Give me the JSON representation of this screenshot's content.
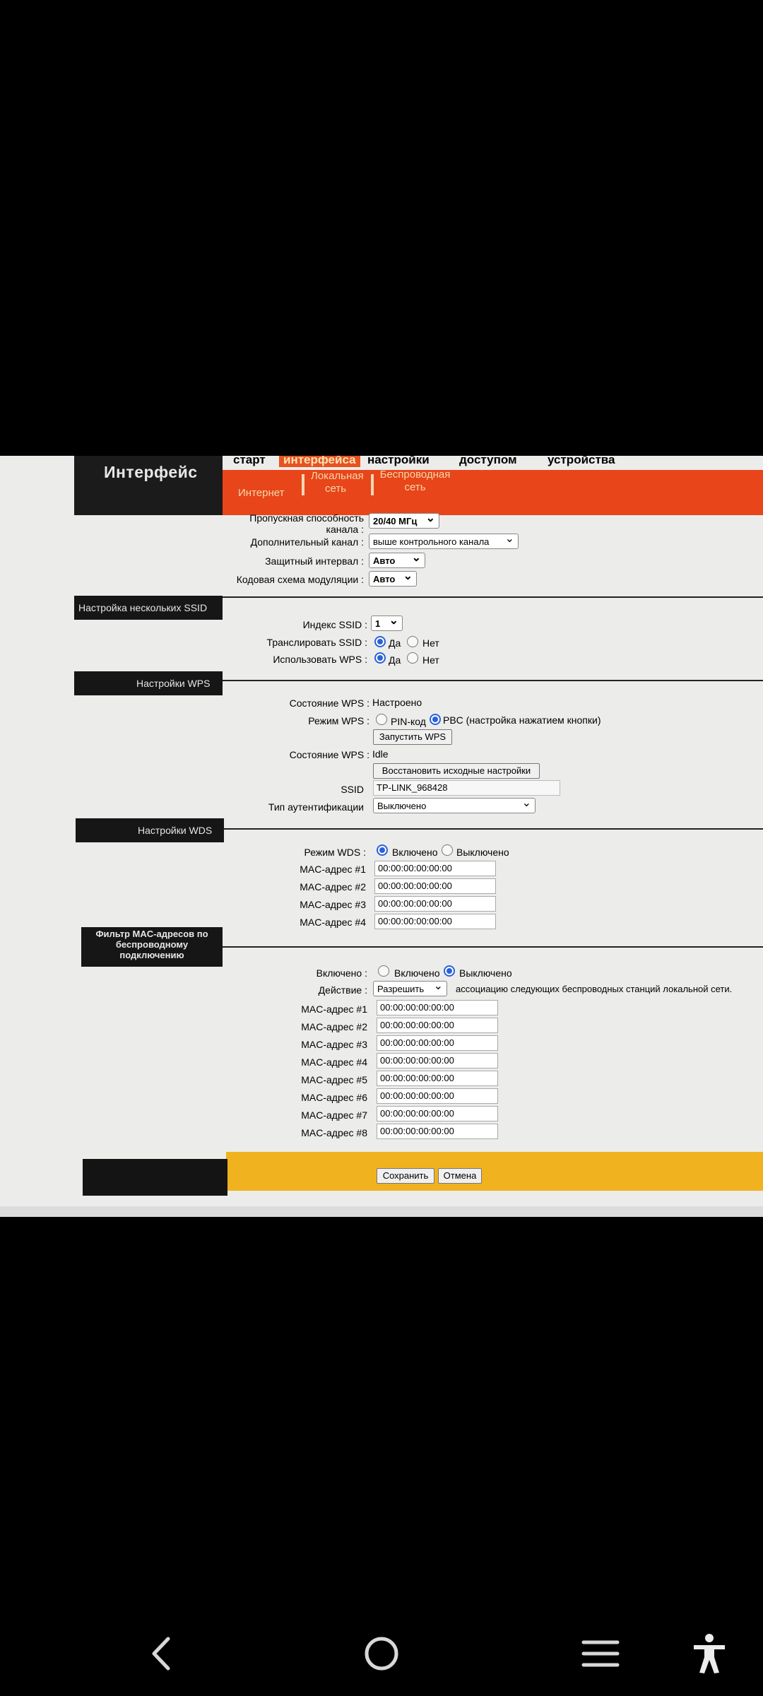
{
  "brand": "Интерфейс",
  "top_menu": [
    "старт",
    "интерфейса",
    "настройки",
    "доступом",
    "устройства"
  ],
  "sub_nav": [
    "Интернет",
    "Локальная\nсеть",
    "Беспроводная\nсеть"
  ],
  "wireless": {
    "bandwidth_label": "Пропускная способность канала",
    "bandwidth_value": "20/40 МГц",
    "ext_channel_label": "Дополнительный канал",
    "ext_channel_value": "выше контрольного канала",
    "guard_label": "Защитный интервал",
    "guard_value": "Авто",
    "mcs_label": "Кодовая схема модуляции",
    "mcs_value": "Авто"
  },
  "multi_ssid": {
    "title": "Настройка нескольких SSID",
    "index_label": "Индекс SSID",
    "index_value": "1",
    "broadcast_label": "Транслировать SSID",
    "use_wps_label": "Использовать WPS",
    "yes": "Да",
    "no": "Нет"
  },
  "wps": {
    "title": "Настройки WPS",
    "state_label": "Состояние WPS",
    "state_value": "Настроено",
    "mode_label": "Режим WPS",
    "pin_label": "PIN-код",
    "pbc_label": "PBC (настройка нажатием кнопки)",
    "start_button": "Запустить WPS",
    "state2_label": "Состояние WPS",
    "state2_value": "Idle",
    "restore_button": "Восстановить исходные настройки",
    "ssid_label": "SSID",
    "ssid_value": "TP-LINK_968428",
    "auth_label": "Тип аутентификации",
    "auth_value": "Выключено"
  },
  "wds": {
    "title": "Настройки WDS",
    "mode_label": "Режим WDS",
    "on": "Включено",
    "off": "Выключено",
    "macs": [
      {
        "label": "MAC-адрес #1",
        "value": "00:00:00:00:00:00"
      },
      {
        "label": "MAC-адрес #2",
        "value": "00:00:00:00:00:00"
      },
      {
        "label": "MAC-адрес #3",
        "value": "00:00:00:00:00:00"
      },
      {
        "label": "MAC-адрес #4",
        "value": "00:00:00:00:00:00"
      }
    ]
  },
  "mac_filter": {
    "title": "Фильтр MAC-адресов по беспроводному подключению",
    "enabled_label": "Включено",
    "on": "Включено",
    "off": "Выключено",
    "action_label": "Действие",
    "action_value": "Разрешить",
    "action_text": "ассоциацию следующих беспроводных станций локальной сети.",
    "macs": [
      {
        "label": "MAC-адрес #1",
        "value": "00:00:00:00:00:00"
      },
      {
        "label": "MAC-адрес #2",
        "value": "00:00:00:00:00:00"
      },
      {
        "label": "MAC-адрес #3",
        "value": "00:00:00:00:00:00"
      },
      {
        "label": "MAC-адрес #4",
        "value": "00:00:00:00:00:00"
      },
      {
        "label": "MAC-адрес #5",
        "value": "00:00:00:00:00:00"
      },
      {
        "label": "MAC-адрес #6",
        "value": "00:00:00:00:00:00"
      },
      {
        "label": "MAC-адрес #7",
        "value": "00:00:00:00:00:00"
      },
      {
        "label": "MAC-адрес #8",
        "value": "00:00:00:00:00:00"
      }
    ]
  },
  "footer": {
    "save": "Сохранить",
    "cancel": "Отмена"
  },
  "colors": {
    "accent_orange": "#e8451a",
    "footer_gold": "#f0b21e",
    "radio_blue": "#2a62d9"
  },
  "nav_icons": [
    "back-icon",
    "home-icon",
    "recents-icon",
    "accessibility-icon"
  ]
}
